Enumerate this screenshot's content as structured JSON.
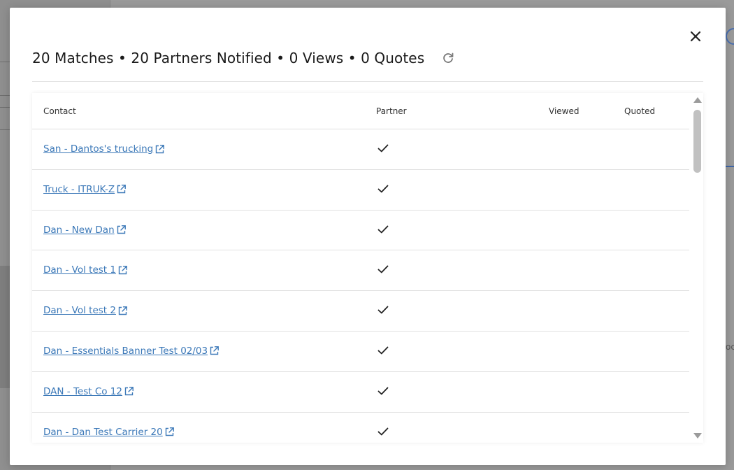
{
  "modal": {
    "summary": "20 Matches • 20 Partners Notified • 0 Views • 0 Quotes",
    "close_icon": "close-icon",
    "refresh_icon": "refresh-icon"
  },
  "table": {
    "columns": {
      "contact": "Contact",
      "partner": "Partner",
      "viewed": "Viewed",
      "quoted": "Quoted"
    },
    "rows": [
      {
        "contact": "San - Dantos's trucking",
        "partner": true
      },
      {
        "contact": "Truck - ITRUK-Z",
        "partner": true
      },
      {
        "contact": "Dan - New Dan",
        "partner": true
      },
      {
        "contact": "Dan - Vol test 1",
        "partner": true
      },
      {
        "contact": "Dan - Vol test 2",
        "partner": true
      },
      {
        "contact": "Dan - Essentials Banner Test 02/03",
        "partner": true
      },
      {
        "contact": "DAN - Test Co 12",
        "partner": true
      },
      {
        "contact": "Dan - Dan Test Carrier 20",
        "partner": true
      }
    ]
  },
  "colors": {
    "link": "#3b78b8",
    "text": "#1a1a1a",
    "divider": "#e0e0e0"
  },
  "background": {
    "partial_text": "oc"
  }
}
